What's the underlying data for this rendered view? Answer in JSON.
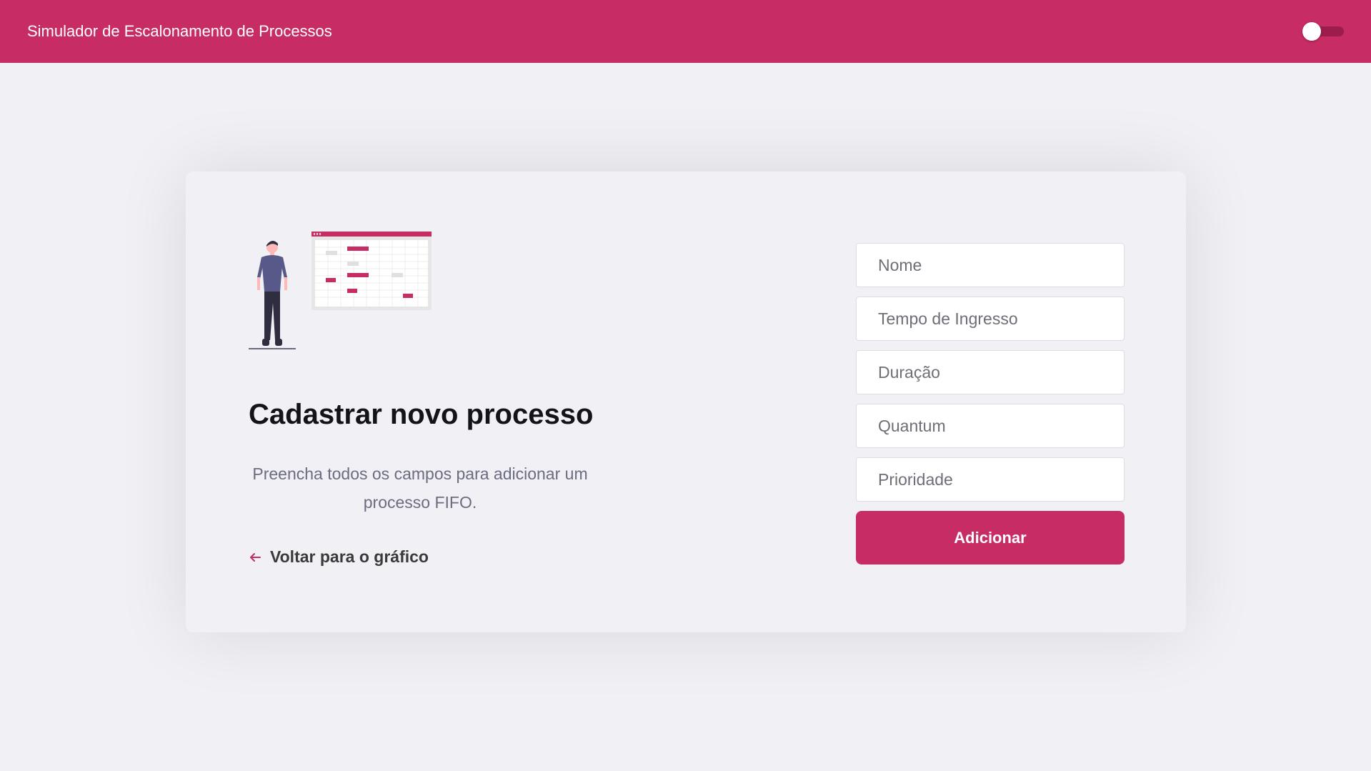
{
  "header": {
    "title": "Simulador de Escalonamento de Processos",
    "theme_toggle_icon": "toggle-switch-icon"
  },
  "card": {
    "illustration_icon": "person-with-schedule-chart-icon",
    "title": "Cadastrar novo processo",
    "description": "Preencha todos os campos para adicionar um processo FIFO.",
    "back_link": {
      "icon": "arrow-left-icon",
      "label": "Voltar para o gráfico"
    }
  },
  "form": {
    "fields": [
      {
        "placeholder": "Nome",
        "value": ""
      },
      {
        "placeholder": "Tempo de Ingresso",
        "value": ""
      },
      {
        "placeholder": "Duração",
        "value": ""
      },
      {
        "placeholder": "Quantum",
        "value": ""
      },
      {
        "placeholder": "Prioridade",
        "value": ""
      }
    ],
    "submit_label": "Adicionar"
  },
  "colors": {
    "accent": "#c72c65",
    "background": "#f0f0f5",
    "title": "#13131a",
    "text_muted": "#6c6c80"
  }
}
